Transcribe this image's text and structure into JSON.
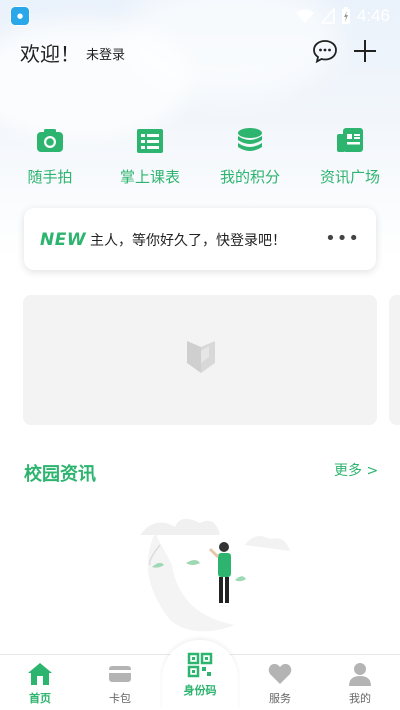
{
  "status_bar": {
    "time": "4:46",
    "app_icon": "app-badge-icon",
    "icons": [
      "wifi-icon",
      "signal-icon",
      "battery-charging-icon"
    ]
  },
  "header": {
    "welcome": "欢迎！",
    "login_state": "未登录",
    "icons": [
      "chat-icon",
      "plus-icon"
    ]
  },
  "quick_actions": [
    {
      "label": "随手拍",
      "icon": "camera-icon"
    },
    {
      "label": "掌上课表",
      "icon": "schedule-icon"
    },
    {
      "label": "我的积分",
      "icon": "coins-icon"
    },
    {
      "label": "资讯广场",
      "icon": "news-icon"
    }
  ],
  "notice": {
    "badge": "NEW",
    "text": "主人，等你好久了，快登录吧！",
    "more": "•••"
  },
  "news": {
    "title": "校园资讯",
    "more": "更多 >"
  },
  "tabbar": {
    "tabs": [
      {
        "label": "首页",
        "icon": "home-icon",
        "active": true
      },
      {
        "label": "卡包",
        "icon": "card-icon",
        "active": false
      },
      {
        "label": "身份码",
        "icon": "qr-code-icon",
        "active": false
      },
      {
        "label": "服务",
        "icon": "heart-icon",
        "active": false
      },
      {
        "label": "我的",
        "icon": "user-icon",
        "active": false
      }
    ]
  },
  "colors": {
    "accent": "#2db46f",
    "muted": "#b4b4b4",
    "banner_bg": "#f3f3f3"
  }
}
